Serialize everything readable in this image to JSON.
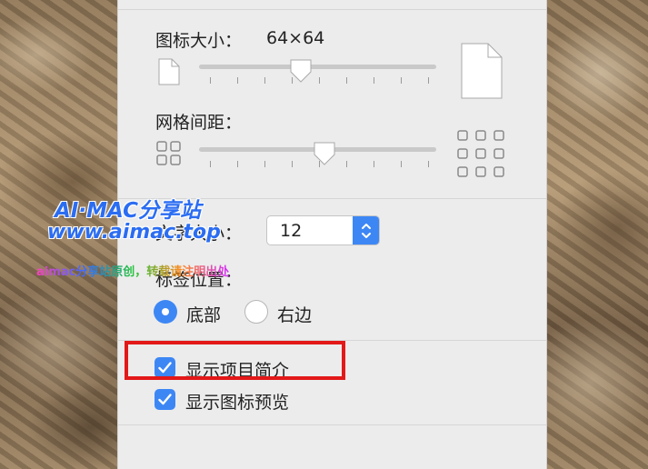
{
  "icon_size": {
    "label": "图标大小：",
    "value": "64×64",
    "slider_fraction": 0.43
  },
  "grid_spacing": {
    "label": "网格间距：",
    "slider_fraction": 0.53
  },
  "text_size": {
    "label": "文字大小：",
    "value": "12"
  },
  "label_position": {
    "label": "标签位置：",
    "options": [
      {
        "label": "底部",
        "selected": true
      },
      {
        "label": "右边",
        "selected": false
      }
    ]
  },
  "checkboxes": [
    {
      "label": "显示项目简介",
      "checked": true
    },
    {
      "label": "显示图标预览",
      "checked": true
    }
  ],
  "watermark": {
    "line1": "AI·MAC分享站",
    "line2": "www.aimac.top",
    "line3": "aimac分享站原创，转载请注明出处"
  },
  "colors": {
    "accent": "#3d87f5",
    "highlight": "#e31818",
    "panel": "#ececec"
  }
}
